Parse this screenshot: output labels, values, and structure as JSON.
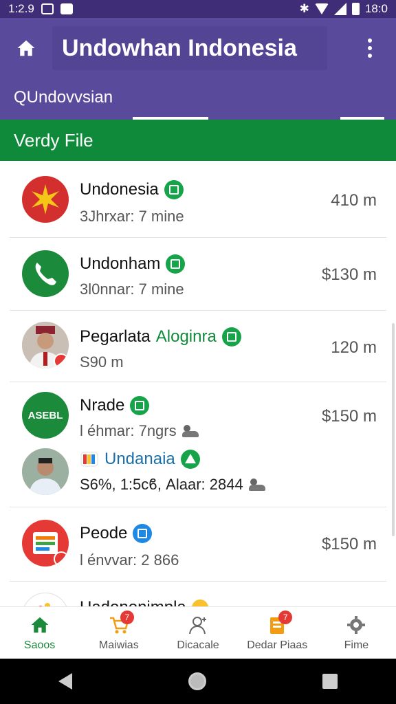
{
  "status_bar": {
    "time_left": "1:2.9",
    "time_right": "18:0"
  },
  "app_bar": {
    "title": "Undowhan Indonesia"
  },
  "tab": {
    "label": "QUndovvsian"
  },
  "section": {
    "title": "Verdy File"
  },
  "rows": [
    {
      "name": "Undonesia",
      "sub": "3Jhrxar: 7 mine",
      "amount": "410 m"
    },
    {
      "name": "Undonham",
      "sub": "3l0nnar: 7 mine",
      "amount": "$130 m"
    },
    {
      "name_a": "Pegarlata",
      "name_b": "Aloginra",
      "sub": "S90 m",
      "amount": "120 m"
    },
    {
      "avatar_text": "ASEBL",
      "name": "Nrade",
      "sub": "l éhmar: 7ngrs",
      "amount": "$150 m",
      "nested_name": "Undanaia",
      "nested_sub": "S6%, 1:5cϐ, Alaar: 2844"
    },
    {
      "name": "Peode",
      "sub": "l énvvar: 2 866",
      "amount": "$150 m"
    },
    {
      "name": "Uadononimpla"
    }
  ],
  "bottom_nav": [
    {
      "label": "Saoos",
      "badge": ""
    },
    {
      "label": "Maiwias",
      "badge": "7"
    },
    {
      "label": "Dicacale",
      "badge": ""
    },
    {
      "label": "Dedar Piaas",
      "badge": "7"
    },
    {
      "label": "Fime",
      "badge": ""
    }
  ],
  "colors": {
    "primary": "#5a4a9c",
    "status": "#3f2d78",
    "green": "#0e8a3a",
    "red": "#e53935",
    "blue": "#1e88e5"
  }
}
